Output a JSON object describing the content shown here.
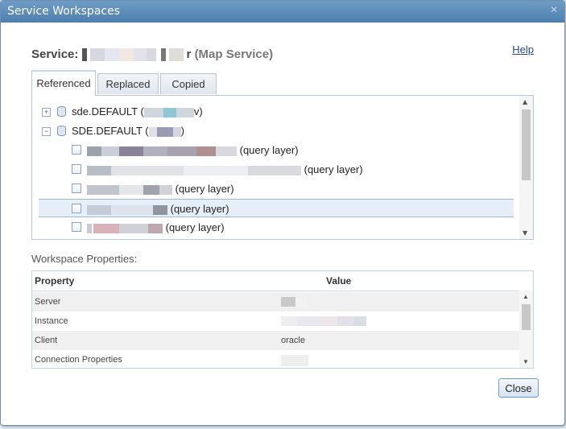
{
  "window": {
    "title": "Service Workspaces"
  },
  "header": {
    "service_prefix": "Service: ",
    "service_name_suffix": "r",
    "service_type": "(Map Service)",
    "help_label": "Help"
  },
  "tabs": [
    {
      "label": "Referenced",
      "active": true
    },
    {
      "label": "Replaced",
      "active": false
    },
    {
      "label": "Copied",
      "active": false
    }
  ],
  "tree": {
    "workspaces": [
      {
        "label_prefix": "sde.DEFAULT (",
        "label_suffix": "v)",
        "expanded": false,
        "expander": "+"
      },
      {
        "label_prefix": "SDE.DEFAULT (",
        "label_suffix": ")",
        "expanded": true,
        "expander": "−"
      }
    ],
    "layers": [
      {
        "suffix": "(query layer)",
        "selected": false
      },
      {
        "suffix": "(query layer)",
        "selected": false
      },
      {
        "suffix": "(query layer)",
        "selected": false
      },
      {
        "suffix": "(query layer)",
        "selected": true
      },
      {
        "suffix": "(query layer)",
        "selected": false
      }
    ]
  },
  "workspace_properties": {
    "label": "Workspace Properties:",
    "columns": {
      "property": "Property",
      "value": "Value"
    },
    "rows": [
      {
        "property": "Server",
        "value": ""
      },
      {
        "property": "Instance",
        "value": ""
      },
      {
        "property": "Client",
        "value": "oracle"
      },
      {
        "property": "Connection Properties",
        "value": ""
      }
    ]
  },
  "footer": {
    "close_label": "Close"
  },
  "colors": {
    "accent": "#4d7fae",
    "selected_row": "#e6eef8",
    "link": "#2a4a8a"
  },
  "icons": {
    "close": "close-icon",
    "database": "database-icon",
    "expand": "expand-icon",
    "collapse": "collapse-icon"
  }
}
